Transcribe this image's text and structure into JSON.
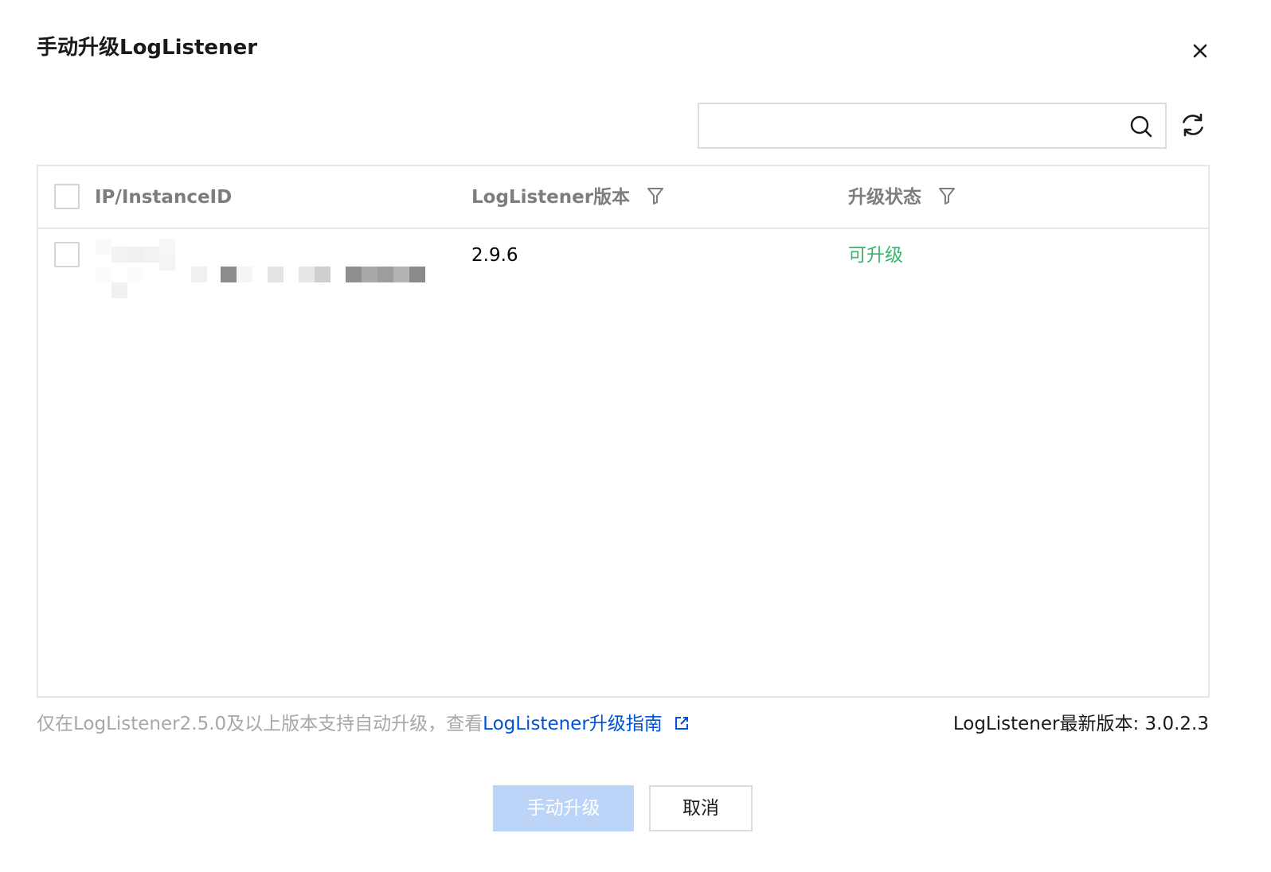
{
  "dialog": {
    "title": "手动升级LogListener",
    "close_icon": "close-icon"
  },
  "toolbar": {
    "search": {
      "placeholder": "",
      "value": "",
      "icon": "search-icon"
    },
    "refresh_icon": "refresh-icon"
  },
  "table": {
    "columns": [
      {
        "label": "IP/InstanceID",
        "filter": false
      },
      {
        "label": "LogListener版本",
        "filter": true
      },
      {
        "label": "升级状态",
        "filter": true
      }
    ],
    "rows": [
      {
        "instance": "[redacted]",
        "version": "2.9.6",
        "status": "可升级",
        "status_color": "#34b76a"
      }
    ]
  },
  "footer": {
    "note_prefix": "仅在LogListener2.5.0及以上版本支持自动升级，查看",
    "guide_link": "LogListener升级指南",
    "latest_version": "LogListener最新版本: 3.0.2.3"
  },
  "actions": {
    "primary_label": "手动升级",
    "primary_disabled": true,
    "secondary_label": "取消"
  },
  "colors": {
    "link": "#0052d9",
    "success": "#34b76a",
    "primary_disabled_bg": "#bcd4f7"
  }
}
